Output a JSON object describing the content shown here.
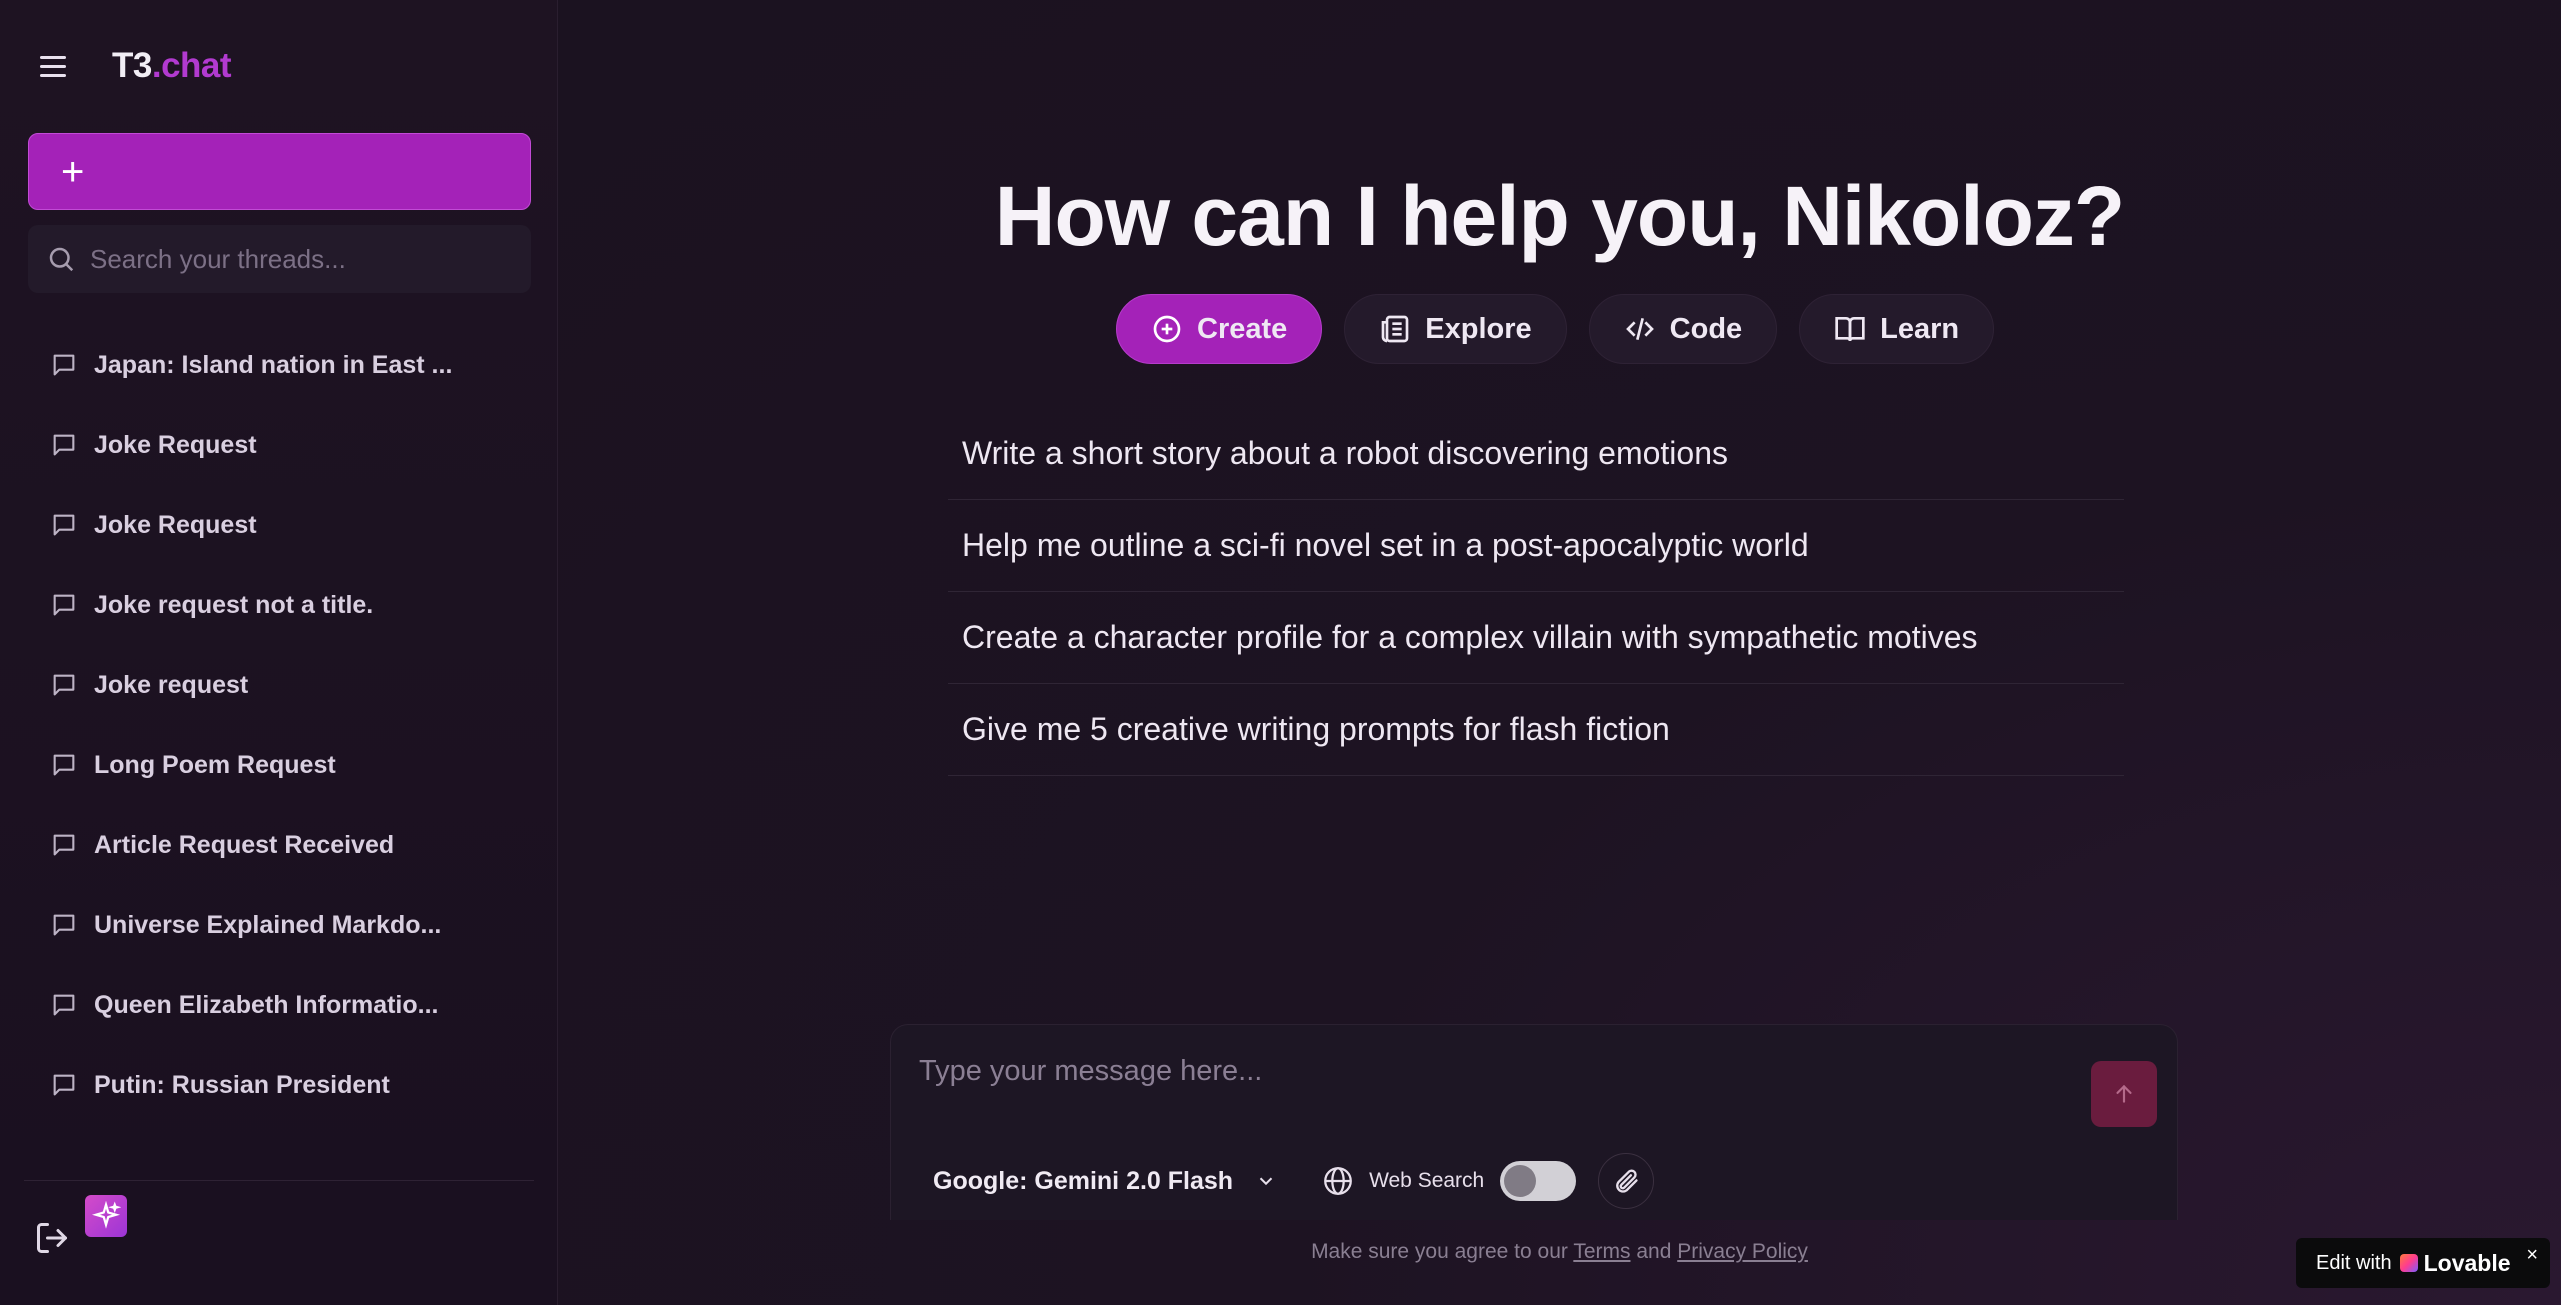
{
  "sidebar": {
    "brand_main": "T3",
    "brand_accent": ".chat",
    "new_chat_icon": "+",
    "search_placeholder": "Search your threads...",
    "threads": [
      {
        "label": "Japan: Island nation in East ..."
      },
      {
        "label": "Joke Request"
      },
      {
        "label": "Joke Request"
      },
      {
        "label": "Joke request not a title."
      },
      {
        "label": "Joke request"
      },
      {
        "label": "Long Poem Request"
      },
      {
        "label": "Article Request Received"
      },
      {
        "label": "Universe Explained Markdo..."
      },
      {
        "label": "Queen Elizabeth Informatio..."
      },
      {
        "label": "Putin: Russian President"
      }
    ]
  },
  "main": {
    "headline": "How can I help you, Nikoloz?",
    "categories": [
      {
        "label": "Create",
        "icon": "plus-circle-icon",
        "active": true
      },
      {
        "label": "Explore",
        "icon": "newspaper-icon",
        "active": false
      },
      {
        "label": "Code",
        "icon": "code-icon",
        "active": false
      },
      {
        "label": "Learn",
        "icon": "book-icon",
        "active": false
      }
    ],
    "suggestions": [
      "Write a short story about a robot discovering emotions",
      "Help me outline a sci-fi novel set in a post-apocalyptic world",
      "Create a character profile for a complex villain with sympathetic motives",
      "Give me 5 creative writing prompts for flash fiction"
    ]
  },
  "composer": {
    "placeholder": "Type your message here...",
    "model": "Google: Gemini 2.0 Flash",
    "web_search_label": "Web Search",
    "web_search_enabled": false
  },
  "footer": {
    "prefix": "Make sure you agree to our ",
    "terms": "Terms",
    "and": " and ",
    "privacy": "Privacy Policy"
  },
  "badge": {
    "prefix": "Edit with",
    "brand": "Lovable",
    "close": "×"
  },
  "colors": {
    "accent": "#a422b8",
    "brand_accent": "#b23ad0",
    "background": "#1c1320"
  }
}
